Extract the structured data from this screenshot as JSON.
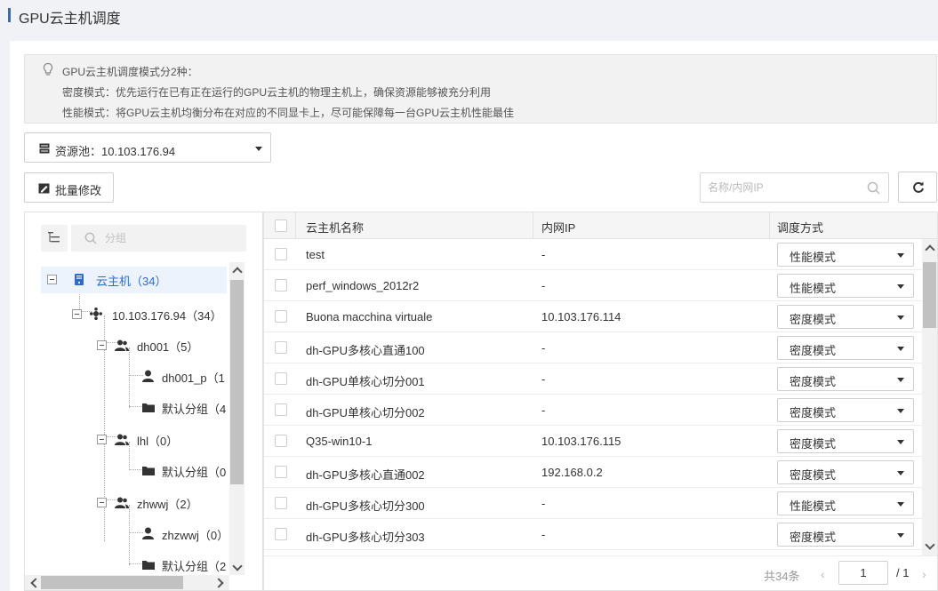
{
  "page": {
    "title": "GPU云主机调度"
  },
  "hint": {
    "lines": [
      "GPU云主机调度模式分2种：",
      "密度模式：优先运行在已有正在运行的GPU云主机的物理主机上，确保资源能够被充分利用",
      "性能模式：将GPU云主机均衡分布在对应的不同显卡上，尽可能保障每一台GPU云主机性能最佳"
    ]
  },
  "pool": {
    "label": "资源池：10.103.176.94"
  },
  "toolbar": {
    "batch_label": "批量修改",
    "search_placeholder": "名称/内网IP"
  },
  "tree": {
    "search_placeholder": "分组",
    "nodes": [
      {
        "label": "云主机（34）"
      },
      {
        "label": "10.103.176.94（34）"
      },
      {
        "label": "dh001（5）"
      },
      {
        "label": "dh001_p（1"
      },
      {
        "label": "默认分组（4"
      },
      {
        "label": "lhl（0）"
      },
      {
        "label": "默认分组（0"
      },
      {
        "label": "zhwwj（2）"
      },
      {
        "label": "zhzwwj（0）"
      },
      {
        "label": "默认分组（2"
      }
    ]
  },
  "table": {
    "columns": [
      "云主机名称",
      "内网IP",
      "调度方式"
    ],
    "rows": [
      {
        "name": "test",
        "ip": "-",
        "mode": "性能模式"
      },
      {
        "name": "perf_windows_2012r2",
        "ip": "-",
        "mode": "性能模式"
      },
      {
        "name": "Buona macchina virtuale",
        "ip": "10.103.176.114",
        "mode": "密度模式"
      },
      {
        "name": "dh-GPU多核心直通100",
        "ip": "-",
        "mode": "密度模式"
      },
      {
        "name": "dh-GPU单核心切分001",
        "ip": "-",
        "mode": "密度模式"
      },
      {
        "name": "dh-GPU单核心切分002",
        "ip": "-",
        "mode": "密度模式"
      },
      {
        "name": "Q35-win10-1",
        "ip": "10.103.176.115",
        "mode": "密度模式"
      },
      {
        "name": "dh-GPU多核心直通002",
        "ip": "192.168.0.2",
        "mode": "密度模式"
      },
      {
        "name": "dh-GPU多核心切分300",
        "ip": "-",
        "mode": "性能模式"
      },
      {
        "name": "dh-GPU多核心切分303",
        "ip": "-",
        "mode": "密度模式"
      }
    ]
  },
  "pagination": {
    "total_text": "共34条",
    "current_page": "1",
    "total_pages": "/ 1",
    "prev": "‹",
    "next": "›"
  },
  "colors": {
    "accent": "#2d6ccf",
    "selected_bg": "#edf3fd"
  }
}
